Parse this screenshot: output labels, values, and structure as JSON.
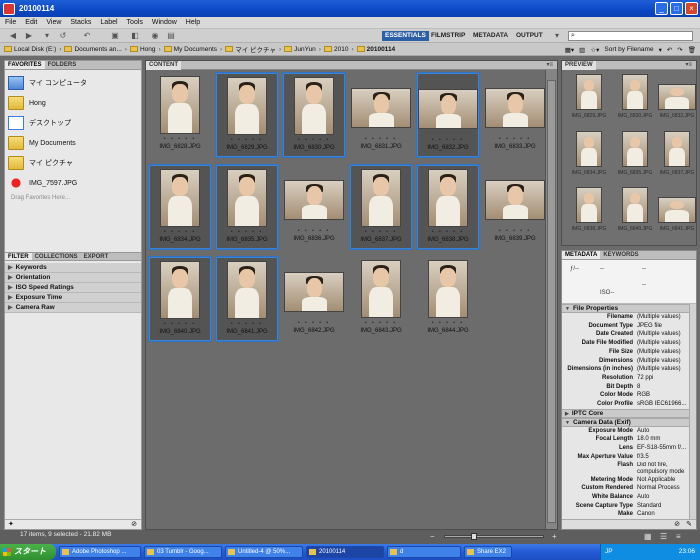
{
  "window": {
    "title": "20100114"
  },
  "menu": [
    "File",
    "Edit",
    "View",
    "Stacks",
    "Label",
    "Tools",
    "Window",
    "Help"
  ],
  "workspaces": [
    {
      "label": "ESSENTIALS",
      "active": true
    },
    {
      "label": "FILMSTRIP",
      "active": false
    },
    {
      "label": "METADATA",
      "active": false
    },
    {
      "label": "OUTPUT",
      "active": false
    }
  ],
  "search": {
    "value": "",
    "placeholder": ""
  },
  "path": {
    "crumbs": [
      "Local Disk (E:)",
      "Documents an...",
      "Hong",
      "My Documents",
      "マイ ピクチャ",
      "JunYun",
      "2010",
      "20100114"
    ],
    "sort_label": "Sort by Filename"
  },
  "left_panel": {
    "tabs": [
      "FAVORITES",
      "FOLDERS"
    ],
    "favorites": [
      {
        "label": "マイ コンピュータ",
        "icon": "computer-icon"
      },
      {
        "label": "Hong",
        "icon": "folder-icon"
      },
      {
        "label": "デスクトップ",
        "icon": "desktop-icon"
      },
      {
        "label": "My Documents",
        "icon": "folder-icon"
      },
      {
        "label": "マイ ピクチャ",
        "icon": "folder-icon"
      },
      {
        "label": "IMG_7597.JPG",
        "icon": "image-icon"
      }
    ],
    "drag_hint": "Drag Favorites Here...",
    "filter_tabs": [
      "FILTER",
      "COLLECTIONS",
      "EXPORT"
    ],
    "filters": [
      "Keywords",
      "Orientation",
      "ISO Speed Ratings",
      "Exposure Time",
      "Camera Raw"
    ]
  },
  "content": {
    "tab": "CONTENT",
    "items": [
      {
        "name": "IMG_6828.JPG",
        "selected": false,
        "orientation": "portrait"
      },
      {
        "name": "IMG_6829.JPG",
        "selected": true,
        "orientation": "portrait"
      },
      {
        "name": "IMG_6830.JPG",
        "selected": true,
        "orientation": "portrait"
      },
      {
        "name": "IMG_6831.JPG",
        "selected": false,
        "orientation": "landscape"
      },
      {
        "name": "IMG_6832.JPG",
        "selected": true,
        "orientation": "landscape"
      },
      {
        "name": "IMG_6833.JPG",
        "selected": false,
        "orientation": "landscape"
      },
      {
        "name": "IMG_6834.JPG",
        "selected": true,
        "orientation": "portrait"
      },
      {
        "name": "IMG_6835.JPG",
        "selected": true,
        "orientation": "portrait"
      },
      {
        "name": "IMG_6836.JPG",
        "selected": false,
        "orientation": "landscape"
      },
      {
        "name": "IMG_6837.JPG",
        "selected": true,
        "orientation": "portrait"
      },
      {
        "name": "IMG_6838.JPG",
        "selected": true,
        "orientation": "portrait"
      },
      {
        "name": "IMG_6839.JPG",
        "selected": false,
        "orientation": "landscape"
      },
      {
        "name": "IMG_6840.JPG",
        "selected": true,
        "orientation": "portrait"
      },
      {
        "name": "IMG_6841.JPG",
        "selected": true,
        "orientation": "portrait"
      },
      {
        "name": "IMG_6842.JPG",
        "selected": false,
        "orientation": "landscape"
      },
      {
        "name": "IMG_6843.JPG",
        "selected": false,
        "orientation": "portrait"
      },
      {
        "name": "IMG_6844.JPG",
        "selected": false,
        "orientation": "portrait"
      }
    ],
    "rating_placeholder": "• • • • •",
    "status": "17 items, 9 selected - 21.82 MB"
  },
  "preview": {
    "tab": "PREVIEW",
    "items": [
      "IMG_6829.JPG",
      "IMG_6830.JPG",
      "IMG_6832.JPG",
      "IMG_6834.JPG",
      "IMG_6835.JPG",
      "IMG_6837.JPG",
      "IMG_6838.JPG",
      "IMG_6840.JPG",
      "IMG_6841.JPG"
    ]
  },
  "metadata": {
    "tabs": [
      "METADATA",
      "KEYWORDS"
    ],
    "camera": {
      "aperture": "ƒ/--",
      "speed": "--",
      "iso": "ISO--",
      "dash": "--"
    },
    "sections": {
      "file": "File Properties",
      "iptc": "IPTC Core",
      "camera": "Camera Data (Exif)"
    },
    "file_properties": [
      {
        "k": "Filename",
        "v": "(Multiple values)"
      },
      {
        "k": "Document Type",
        "v": "JPEG file"
      },
      {
        "k": "Date Created",
        "v": "(Multiple values)"
      },
      {
        "k": "Date File Modified",
        "v": "(Multiple values)"
      },
      {
        "k": "File Size",
        "v": "(Multiple values)"
      },
      {
        "k": "Dimensions",
        "v": "(Multiple values)"
      },
      {
        "k": "Dimensions (in inches)",
        "v": "(Multiple values)"
      },
      {
        "k": "Resolution",
        "v": "72 ppi"
      },
      {
        "k": "Bit Depth",
        "v": "8"
      },
      {
        "k": "Color Mode",
        "v": "RGB"
      },
      {
        "k": "Color Profile",
        "v": "sRGB IEC61966..."
      }
    ],
    "camera_data": [
      {
        "k": "Exposure Mode",
        "v": "Auto"
      },
      {
        "k": "Focal Length",
        "v": "18.0 mm"
      },
      {
        "k": "Lens",
        "v": "EF-S18-55mm f/..."
      },
      {
        "k": "Max Aperture Value",
        "v": "f/3.5"
      },
      {
        "k": "Flash",
        "v": "Did not fire, compulsory mode"
      },
      {
        "k": "Metering Mode",
        "v": "Not Applicable"
      },
      {
        "k": "Custom Rendered",
        "v": "Normal Process"
      },
      {
        "k": "White Balance",
        "v": "Auto"
      },
      {
        "k": "Scene Capture Type",
        "v": "Standard"
      },
      {
        "k": "Make",
        "v": "Canon"
      }
    ]
  },
  "taskbar": {
    "start": "スタート",
    "tasks": [
      {
        "label": "Adobe Photoshop ...",
        "active": false
      },
      {
        "label": "03 Tumblr - Goog...",
        "active": false
      },
      {
        "label": "Untitled-4 @ 50%...",
        "active": false
      },
      {
        "label": "20100114",
        "active": true
      },
      {
        "label": "d",
        "active": false
      },
      {
        "label": "Share EX2",
        "active": false
      }
    ],
    "tray_lang": "JP",
    "clock": "23:06"
  }
}
